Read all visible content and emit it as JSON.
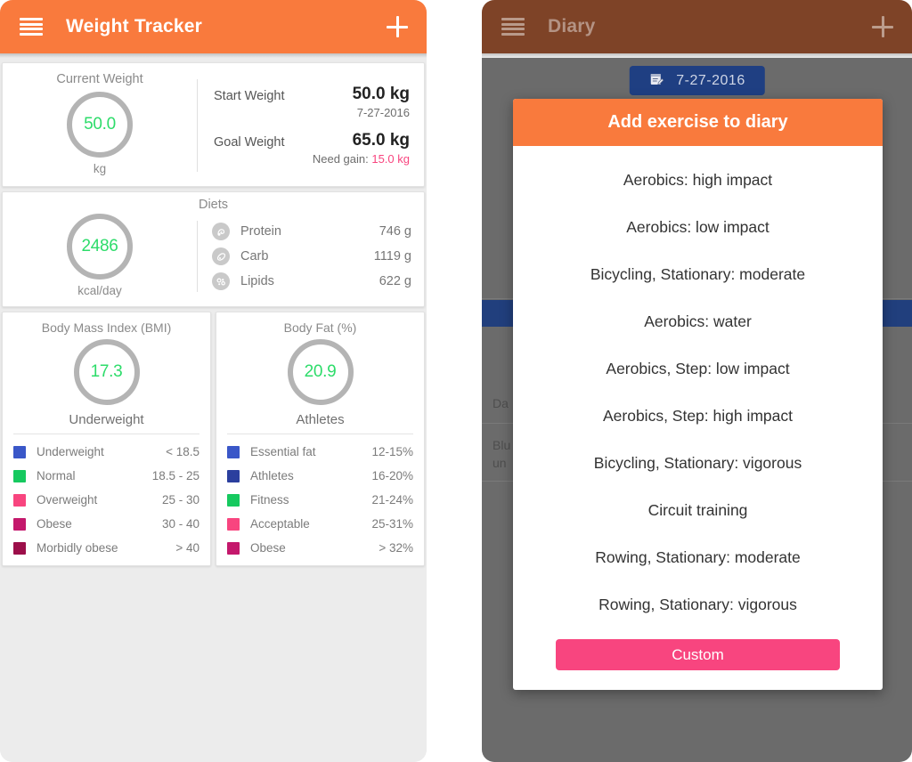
{
  "left_panel": {
    "appbar": {
      "title": "Weight Tracker",
      "menu_icon": "hamburger-menu-icon",
      "add_icon": "plus-icon"
    },
    "current_weight": {
      "label": "Current Weight",
      "value": "50.0",
      "unit": "kg"
    },
    "weight_stats": [
      {
        "label": "Start Weight",
        "value": "50.0 kg",
        "sub": "7-27-2016",
        "sub_accent": ""
      },
      {
        "label": "Goal Weight",
        "value": "65.0 kg",
        "sub": "Need gain: ",
        "sub_accent": "15.0 kg"
      }
    ],
    "diets": {
      "title": "Diets",
      "value": "2486",
      "unit": "kcal/day",
      "items": [
        {
          "icon": "protein-icon",
          "name": "Protein",
          "value": "746 g"
        },
        {
          "icon": "carb-icon",
          "name": "Carb",
          "value": "1119 g"
        },
        {
          "icon": "lipids-icon",
          "name": "Lipids",
          "value": "622 g"
        }
      ]
    },
    "bmi": {
      "title": "Body Mass Index (BMI)",
      "value": "17.3",
      "status": "Underweight",
      "legend": [
        {
          "color": "#3a57c8",
          "name": "Underweight",
          "range": "< 18.5"
        },
        {
          "color": "#16c95f",
          "name": "Normal",
          "range": "18.5 - 25"
        },
        {
          "color": "#f8457f",
          "name": "Overweight",
          "range": "25 - 30"
        },
        {
          "color": "#c4186c",
          "name": "Obese",
          "range": "30 - 40"
        },
        {
          "color": "#9c0f4a",
          "name": "Morbidly obese",
          "range": "> 40"
        }
      ]
    },
    "body_fat": {
      "title": "Body Fat (%)",
      "value": "20.9",
      "status": "Athletes",
      "legend": [
        {
          "color": "#3a57c8",
          "name": "Essential fat",
          "range": "12-15%"
        },
        {
          "color": "#2b3f9e",
          "name": "Athletes",
          "range": "16-20%"
        },
        {
          "color": "#16c95f",
          "name": "Fitness",
          "range": "21-24%"
        },
        {
          "color": "#f8457f",
          "name": "Acceptable",
          "range": "25-31%"
        },
        {
          "color": "#c4186c",
          "name": "Obese",
          "range": "> 32%"
        }
      ]
    }
  },
  "right_panel": {
    "appbar": {
      "title": "Diary",
      "menu_icon": "hamburger-menu-icon",
      "add_icon": "plus-icon"
    },
    "date_chip": {
      "icon": "calendar-icon",
      "text": "7-27-2016"
    },
    "background_text": {
      "line1": "Da",
      "line2": "Blu\nun"
    },
    "dialog": {
      "title": "Add exercise to diary",
      "items": [
        "Aerobics: high impact",
        "Aerobics: low impact",
        "Bicycling, Stationary: moderate",
        "Aerobics: water",
        "Aerobics, Step: low impact",
        "Aerobics, Step: high impact",
        "Bicycling, Stationary: vigorous",
        "Circuit training",
        "Rowing, Stationary: moderate",
        "Rowing, Stationary: vigorous"
      ],
      "custom_button": "Custom"
    }
  },
  "colors": {
    "accent_orange": "#f97a3d",
    "accent_pink": "#f8457f",
    "value_green": "#2ddc6a",
    "chip_blue": "#1f3f82",
    "scrim_gray": "#6b6b6b",
    "dim_brown": "#7e4327"
  }
}
